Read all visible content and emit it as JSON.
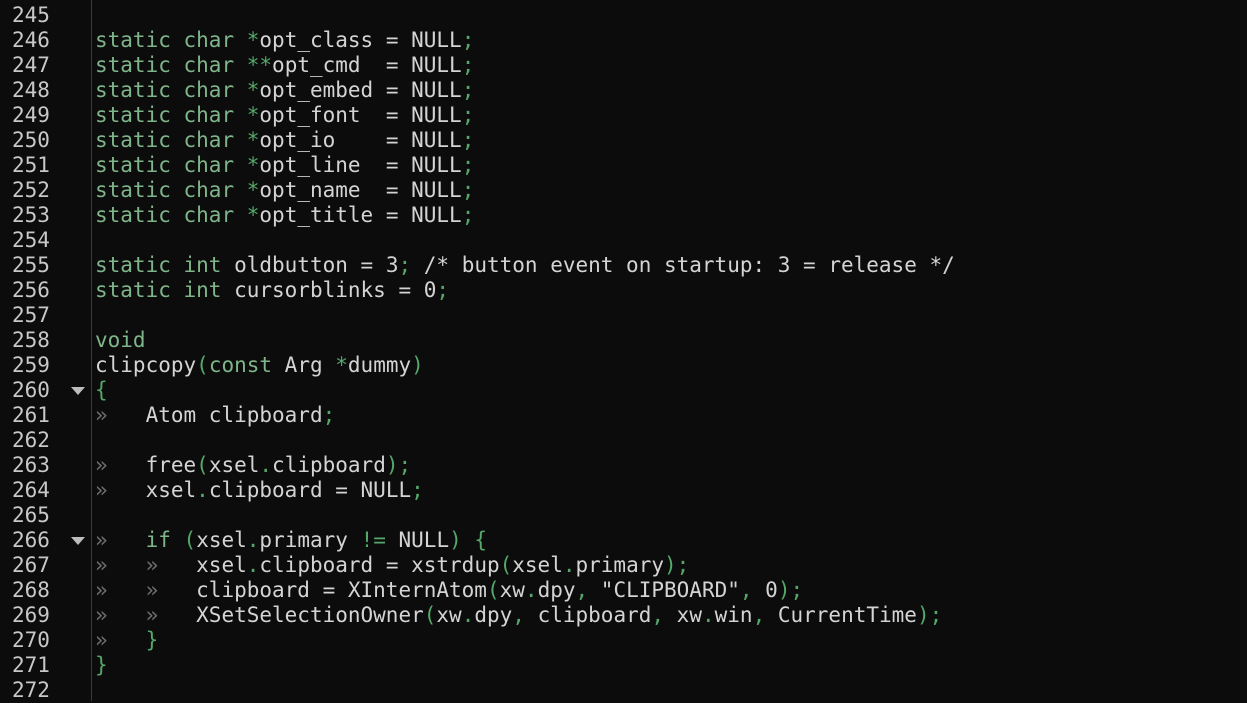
{
  "editor": {
    "lines": [
      {
        "n": "245",
        "fold": false,
        "tokens": []
      },
      {
        "n": "246",
        "fold": false,
        "tokens": [
          {
            "t": "kw",
            "v": "static"
          },
          {
            "t": "id",
            "v": " "
          },
          {
            "t": "kw",
            "v": "char"
          },
          {
            "t": "id",
            "v": " "
          },
          {
            "t": "op",
            "v": "*"
          },
          {
            "t": "id",
            "v": "opt_class = NULL"
          },
          {
            "t": "op",
            "v": ";"
          }
        ]
      },
      {
        "n": "247",
        "fold": false,
        "tokens": [
          {
            "t": "kw",
            "v": "static"
          },
          {
            "t": "id",
            "v": " "
          },
          {
            "t": "kw",
            "v": "char"
          },
          {
            "t": "id",
            "v": " "
          },
          {
            "t": "op",
            "v": "**"
          },
          {
            "t": "id",
            "v": "opt_cmd  = NULL"
          },
          {
            "t": "op",
            "v": ";"
          }
        ]
      },
      {
        "n": "248",
        "fold": false,
        "tokens": [
          {
            "t": "kw",
            "v": "static"
          },
          {
            "t": "id",
            "v": " "
          },
          {
            "t": "kw",
            "v": "char"
          },
          {
            "t": "id",
            "v": " "
          },
          {
            "t": "op",
            "v": "*"
          },
          {
            "t": "id",
            "v": "opt_embed = NULL"
          },
          {
            "t": "op",
            "v": ";"
          }
        ]
      },
      {
        "n": "249",
        "fold": false,
        "tokens": [
          {
            "t": "kw",
            "v": "static"
          },
          {
            "t": "id",
            "v": " "
          },
          {
            "t": "kw",
            "v": "char"
          },
          {
            "t": "id",
            "v": " "
          },
          {
            "t": "op",
            "v": "*"
          },
          {
            "t": "id",
            "v": "opt_font  = NULL"
          },
          {
            "t": "op",
            "v": ";"
          }
        ]
      },
      {
        "n": "250",
        "fold": false,
        "tokens": [
          {
            "t": "kw",
            "v": "static"
          },
          {
            "t": "id",
            "v": " "
          },
          {
            "t": "kw",
            "v": "char"
          },
          {
            "t": "id",
            "v": " "
          },
          {
            "t": "op",
            "v": "*"
          },
          {
            "t": "id",
            "v": "opt_io    = NULL"
          },
          {
            "t": "op",
            "v": ";"
          }
        ]
      },
      {
        "n": "251",
        "fold": false,
        "tokens": [
          {
            "t": "kw",
            "v": "static"
          },
          {
            "t": "id",
            "v": " "
          },
          {
            "t": "kw",
            "v": "char"
          },
          {
            "t": "id",
            "v": " "
          },
          {
            "t": "op",
            "v": "*"
          },
          {
            "t": "id",
            "v": "opt_line  = NULL"
          },
          {
            "t": "op",
            "v": ";"
          }
        ]
      },
      {
        "n": "252",
        "fold": false,
        "tokens": [
          {
            "t": "kw",
            "v": "static"
          },
          {
            "t": "id",
            "v": " "
          },
          {
            "t": "kw",
            "v": "char"
          },
          {
            "t": "id",
            "v": " "
          },
          {
            "t": "op",
            "v": "*"
          },
          {
            "t": "id",
            "v": "opt_name  = NULL"
          },
          {
            "t": "op",
            "v": ";"
          }
        ]
      },
      {
        "n": "253",
        "fold": false,
        "tokens": [
          {
            "t": "kw",
            "v": "static"
          },
          {
            "t": "id",
            "v": " "
          },
          {
            "t": "kw",
            "v": "char"
          },
          {
            "t": "id",
            "v": " "
          },
          {
            "t": "op",
            "v": "*"
          },
          {
            "t": "id",
            "v": "opt_title = NULL"
          },
          {
            "t": "op",
            "v": ";"
          }
        ]
      },
      {
        "n": "254",
        "fold": false,
        "tokens": []
      },
      {
        "n": "255",
        "fold": false,
        "tokens": [
          {
            "t": "kw",
            "v": "static"
          },
          {
            "t": "id",
            "v": " "
          },
          {
            "t": "kw",
            "v": "int"
          },
          {
            "t": "id",
            "v": " oldbutton = 3"
          },
          {
            "t": "op",
            "v": ";"
          },
          {
            "t": "com",
            "v": " /* button event on startup: 3 = release */"
          }
        ]
      },
      {
        "n": "256",
        "fold": false,
        "tokens": [
          {
            "t": "kw",
            "v": "static"
          },
          {
            "t": "id",
            "v": " "
          },
          {
            "t": "kw",
            "v": "int"
          },
          {
            "t": "id",
            "v": " cursorblinks = 0"
          },
          {
            "t": "op",
            "v": ";"
          }
        ]
      },
      {
        "n": "257",
        "fold": false,
        "tokens": []
      },
      {
        "n": "258",
        "fold": false,
        "tokens": [
          {
            "t": "kw",
            "v": "void"
          }
        ]
      },
      {
        "n": "259",
        "fold": false,
        "tokens": [
          {
            "t": "id",
            "v": "clipcopy"
          },
          {
            "t": "op",
            "v": "("
          },
          {
            "t": "kw",
            "v": "const"
          },
          {
            "t": "id",
            "v": " Arg "
          },
          {
            "t": "op",
            "v": "*"
          },
          {
            "t": "id",
            "v": "dummy"
          },
          {
            "t": "op",
            "v": ")"
          }
        ]
      },
      {
        "n": "260",
        "fold": true,
        "tokens": [
          {
            "t": "op",
            "v": "{"
          }
        ]
      },
      {
        "n": "261",
        "fold": false,
        "tokens": [
          {
            "t": "tab",
            "v": "»   "
          },
          {
            "t": "id",
            "v": "Atom clipboard"
          },
          {
            "t": "op",
            "v": ";"
          }
        ]
      },
      {
        "n": "262",
        "fold": false,
        "tokens": []
      },
      {
        "n": "263",
        "fold": false,
        "tokens": [
          {
            "t": "tab",
            "v": "»   "
          },
          {
            "t": "id",
            "v": "free"
          },
          {
            "t": "op",
            "v": "("
          },
          {
            "t": "id",
            "v": "xsel"
          },
          {
            "t": "op",
            "v": "."
          },
          {
            "t": "id",
            "v": "clipboard"
          },
          {
            "t": "op",
            "v": ");"
          }
        ]
      },
      {
        "n": "264",
        "fold": false,
        "tokens": [
          {
            "t": "tab",
            "v": "»   "
          },
          {
            "t": "id",
            "v": "xsel"
          },
          {
            "t": "op",
            "v": "."
          },
          {
            "t": "id",
            "v": "clipboard = NULL"
          },
          {
            "t": "op",
            "v": ";"
          }
        ]
      },
      {
        "n": "265",
        "fold": false,
        "tokens": []
      },
      {
        "n": "266",
        "fold": true,
        "tokens": [
          {
            "t": "tab",
            "v": "»   "
          },
          {
            "t": "kw",
            "v": "if"
          },
          {
            "t": "id",
            "v": " "
          },
          {
            "t": "op",
            "v": "("
          },
          {
            "t": "id",
            "v": "xsel"
          },
          {
            "t": "op",
            "v": "."
          },
          {
            "t": "id",
            "v": "primary "
          },
          {
            "t": "op",
            "v": "!="
          },
          {
            "t": "id",
            "v": " NULL"
          },
          {
            "t": "op",
            "v": ") {"
          }
        ]
      },
      {
        "n": "267",
        "fold": false,
        "tokens": [
          {
            "t": "tab",
            "v": "»   »   "
          },
          {
            "t": "id",
            "v": "xsel"
          },
          {
            "t": "op",
            "v": "."
          },
          {
            "t": "id",
            "v": "clipboard = xstrdup"
          },
          {
            "t": "op",
            "v": "("
          },
          {
            "t": "id",
            "v": "xsel"
          },
          {
            "t": "op",
            "v": "."
          },
          {
            "t": "id",
            "v": "primary"
          },
          {
            "t": "op",
            "v": ");"
          }
        ]
      },
      {
        "n": "268",
        "fold": false,
        "tokens": [
          {
            "t": "tab",
            "v": "»   »   "
          },
          {
            "t": "id",
            "v": "clipboard = XInternAtom"
          },
          {
            "t": "op",
            "v": "("
          },
          {
            "t": "id",
            "v": "xw"
          },
          {
            "t": "op",
            "v": "."
          },
          {
            "t": "id",
            "v": "dpy"
          },
          {
            "t": "op",
            "v": ","
          },
          {
            "t": "str",
            "v": " \"CLIPBOARD\""
          },
          {
            "t": "op",
            "v": ","
          },
          {
            "t": "num",
            "v": " 0"
          },
          {
            "t": "op",
            "v": ");"
          }
        ]
      },
      {
        "n": "269",
        "fold": false,
        "tokens": [
          {
            "t": "tab",
            "v": "»   »   "
          },
          {
            "t": "id",
            "v": "XSetSelectionOwner"
          },
          {
            "t": "op",
            "v": "("
          },
          {
            "t": "id",
            "v": "xw"
          },
          {
            "t": "op",
            "v": "."
          },
          {
            "t": "id",
            "v": "dpy"
          },
          {
            "t": "op",
            "v": ","
          },
          {
            "t": "id",
            "v": " clipboard"
          },
          {
            "t": "op",
            "v": ","
          },
          {
            "t": "id",
            "v": " xw"
          },
          {
            "t": "op",
            "v": "."
          },
          {
            "t": "id",
            "v": "win"
          },
          {
            "t": "op",
            "v": ","
          },
          {
            "t": "id",
            "v": " CurrentTime"
          },
          {
            "t": "op",
            "v": ");"
          }
        ]
      },
      {
        "n": "270",
        "fold": false,
        "tokens": [
          {
            "t": "tab",
            "v": "»   "
          },
          {
            "t": "op",
            "v": "}"
          }
        ]
      },
      {
        "n": "271",
        "fold": false,
        "tokens": [
          {
            "t": "op",
            "v": "}"
          }
        ]
      },
      {
        "n": "272",
        "fold": false,
        "tokens": []
      }
    ]
  }
}
